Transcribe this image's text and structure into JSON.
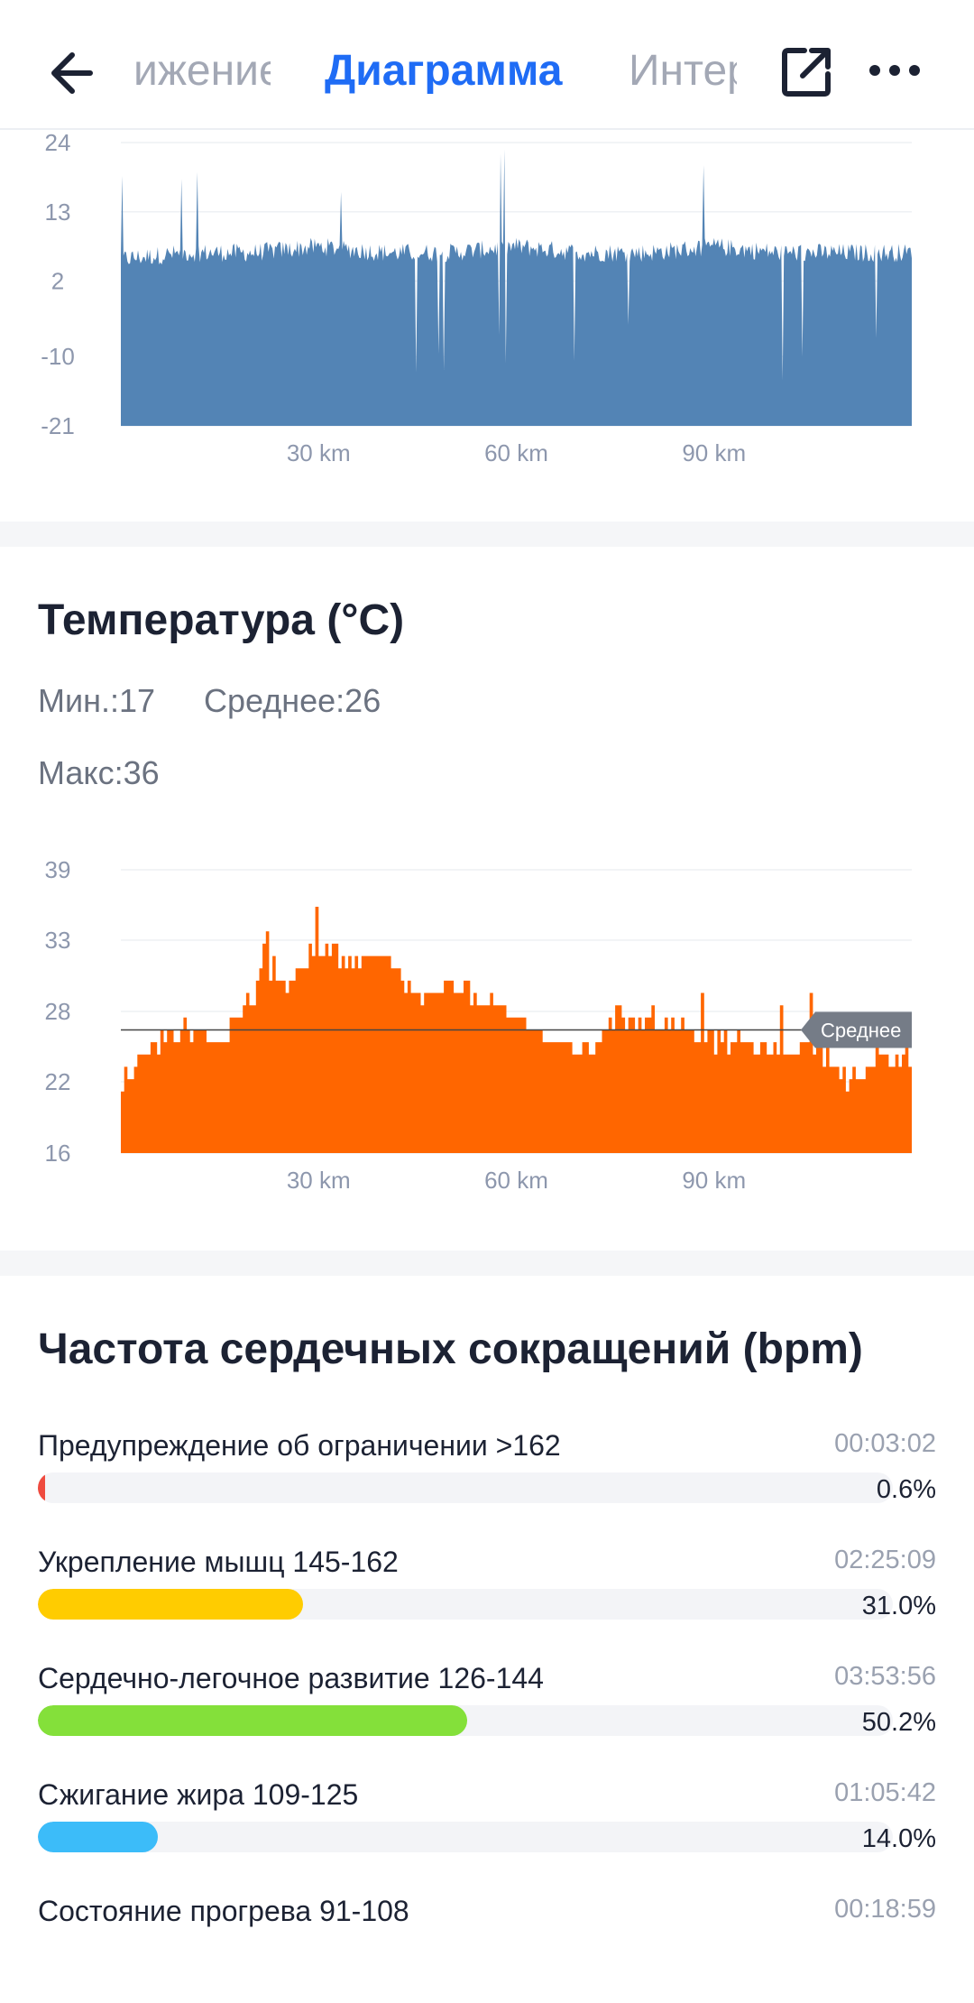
{
  "header": {
    "tab_left": "Движение",
    "tab_active": "Диаграмма",
    "tab_right": "Интервалы",
    "back_icon": "arrow-left-icon",
    "share_icon": "share-icon",
    "more_icon": "more-icon"
  },
  "elevation_chart": {
    "y_ticks": [
      "24",
      "13",
      "2",
      "-10",
      "-21"
    ],
    "x_ticks": [
      "30 km",
      "60 km",
      "90 km"
    ],
    "color": "#5384b5"
  },
  "temperature": {
    "title": "Температура (°C)",
    "min": "Мин.:17",
    "avg": "Среднее:26",
    "max": "Макс:36",
    "avg_label": "Среднее",
    "y_ticks": [
      "39",
      "33",
      "28",
      "22",
      "16"
    ],
    "x_ticks": [
      "30 km",
      "60 km",
      "90 km"
    ],
    "color": "#ff6600"
  },
  "heart_rate": {
    "title": "Частота сердечных сокращений (bpm)",
    "zones": [
      {
        "label": "Предупреждение об ограничении  >162",
        "time": "00:03:02",
        "pct": "0.6%",
        "value": 0.6,
        "color": "#ef4b3f"
      },
      {
        "label": "Укрепление мышц  145-162",
        "time": "02:25:09",
        "pct": "31.0%",
        "value": 31.0,
        "color": "#ffcc00"
      },
      {
        "label": "Сердечно-легочное развитие  126-144",
        "time": "03:53:56",
        "pct": "50.2%",
        "value": 50.2,
        "color": "#84e03a"
      },
      {
        "label": "Сжигание жира  109-125",
        "time": "01:05:42",
        "pct": "14.0%",
        "value": 14.0,
        "color": "#3cbcf9"
      },
      {
        "label": "Состояние прогрева  91-108",
        "time": "00:18:59",
        "pct": "",
        "value": 0,
        "color": "#7fb2ff"
      }
    ]
  },
  "chart_data": [
    {
      "type": "area",
      "title": "",
      "xlabel": "",
      "ylabel": "",
      "x_ticks": [
        "30 km",
        "60 km",
        "90 km"
      ],
      "ylim": [
        -21,
        24
      ],
      "x": [
        0,
        10,
        20,
        30,
        40,
        50,
        60,
        70,
        80,
        90,
        100,
        110,
        120
      ],
      "values": [
        5,
        6,
        6,
        7,
        6,
        6,
        7,
        6,
        6,
        7,
        6,
        6,
        6
      ]
    },
    {
      "type": "area",
      "title": "Температура (°C)",
      "xlabel": "",
      "ylabel": "",
      "x_ticks": [
        "30 km",
        "60 km",
        "90 km"
      ],
      "ylim": [
        16,
        39
      ],
      "x": [
        0,
        5,
        10,
        15,
        20,
        25,
        30,
        35,
        40,
        45,
        50,
        55,
        60,
        65,
        70,
        75,
        80,
        85,
        90,
        95,
        100,
        105,
        110,
        115,
        120
      ],
      "values": [
        22,
        25,
        26,
        25,
        29,
        30,
        33,
        31,
        32,
        28,
        30,
        28,
        27,
        25,
        24,
        27,
        27,
        26,
        25,
        25,
        24,
        25,
        22,
        23,
        24
      ],
      "reference_line": {
        "label": "Среднее",
        "value": 26
      }
    }
  ]
}
